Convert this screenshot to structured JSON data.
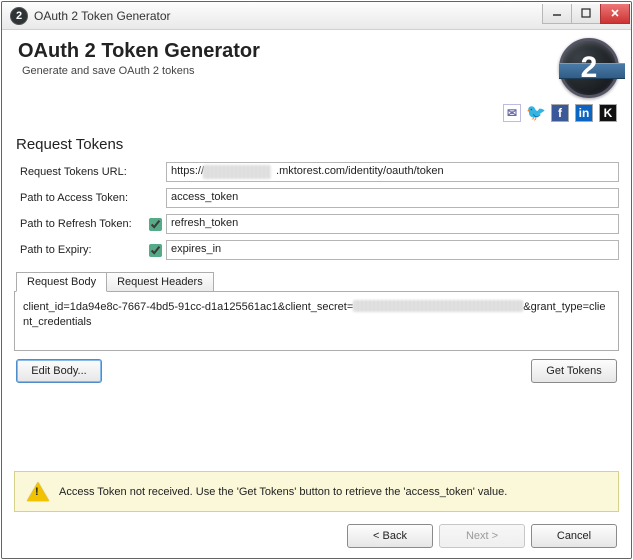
{
  "window": {
    "title": "OAuth 2 Token Generator"
  },
  "header": {
    "title": "OAuth 2 Token Generator",
    "subtitle": "Generate and save OAuth 2 tokens",
    "logo_text": "2"
  },
  "social": {
    "mail": "✉",
    "twitter": "🐦",
    "facebook": "f",
    "linkedin": "in",
    "k": "K"
  },
  "section": {
    "title": "Request Tokens",
    "url_label": "Request Tokens URL:",
    "url_prefix": "https://",
    "url_suffix": ".mktorest.com/identity/oauth/token",
    "access_label": "Path to Access Token:",
    "access_value": "access_token",
    "refresh_label": "Path to Refresh Token:",
    "refresh_value": "refresh_token",
    "refresh_checked": true,
    "expiry_label": "Path to Expiry:",
    "expiry_value": "expires_in",
    "expiry_checked": true
  },
  "tabs": {
    "body": "Request Body",
    "headers": "Request Headers",
    "body_prefix": "client_id=1da94e8c-7667-4bd5-91cc-d1a125561ac1&client_secret=",
    "body_suffix": "&grant_type=client_credentials"
  },
  "buttons": {
    "edit_body": "Edit Body...",
    "get_tokens": "Get Tokens",
    "back": "< Back",
    "next": "Next >",
    "cancel": "Cancel"
  },
  "warning": {
    "text": "Access Token not received. Use the 'Get Tokens' button to retrieve the 'access_token' value."
  }
}
